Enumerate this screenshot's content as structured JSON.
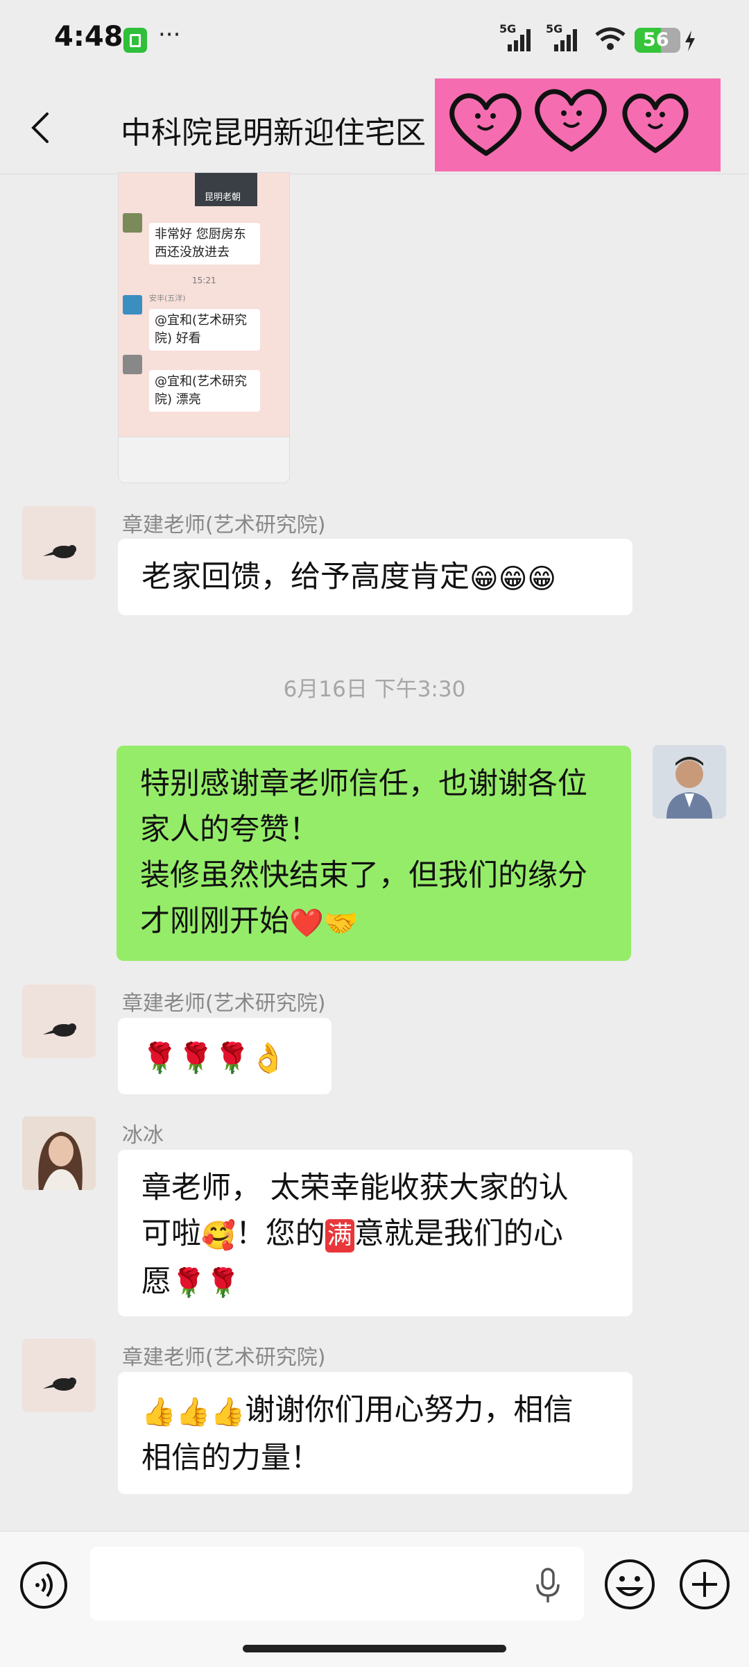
{
  "status": {
    "time": "4:48",
    "dots": "···",
    "network1": "5G",
    "network2": "5G",
    "battery": "56"
  },
  "header": {
    "title": "中科院昆明新迎住宅区"
  },
  "screenshot": {
    "tag": "昆明老朝",
    "msg1": "非常好 您厨房东西还没放进去",
    "time": "15:21",
    "name2": "安丰(五洋)",
    "msg2": "@宜和(艺术研究院) 好看",
    "msg3": "@宜和(艺术研究院) 漂亮"
  },
  "messages": [
    {
      "sender": "章建老师(艺术研究院)",
      "text": "老家回馈，给予高度肯定"
    },
    {
      "timestamp": "6月16日 下午3:30"
    },
    {
      "line1": "特别感谢章老师信任，也谢谢各位",
      "line2": "家人的夸赞！",
      "line3": "装修虽然快结束了，但我们的缘分",
      "line4": "才刚刚开始"
    },
    {
      "sender": "章建老师(艺术研究院)"
    },
    {
      "sender": "冰冰",
      "line1": "章老师， 太荣幸能收获大家的认",
      "line2a": "可啦",
      "line2b": "！您的",
      "line2c": "意就是我们的心",
      "line3": "愿",
      "badge": "满"
    },
    {
      "sender": "章建老师(艺术研究院)",
      "line1": "谢谢你们用心努力，相信",
      "line2": "相信的力量！"
    }
  ],
  "icons": [
    "back-arrow",
    "voice",
    "microphone",
    "emoji",
    "plus"
  ],
  "colors": {
    "sent_bubble": "#95ec69",
    "sticker_bg": "#f56db0"
  }
}
